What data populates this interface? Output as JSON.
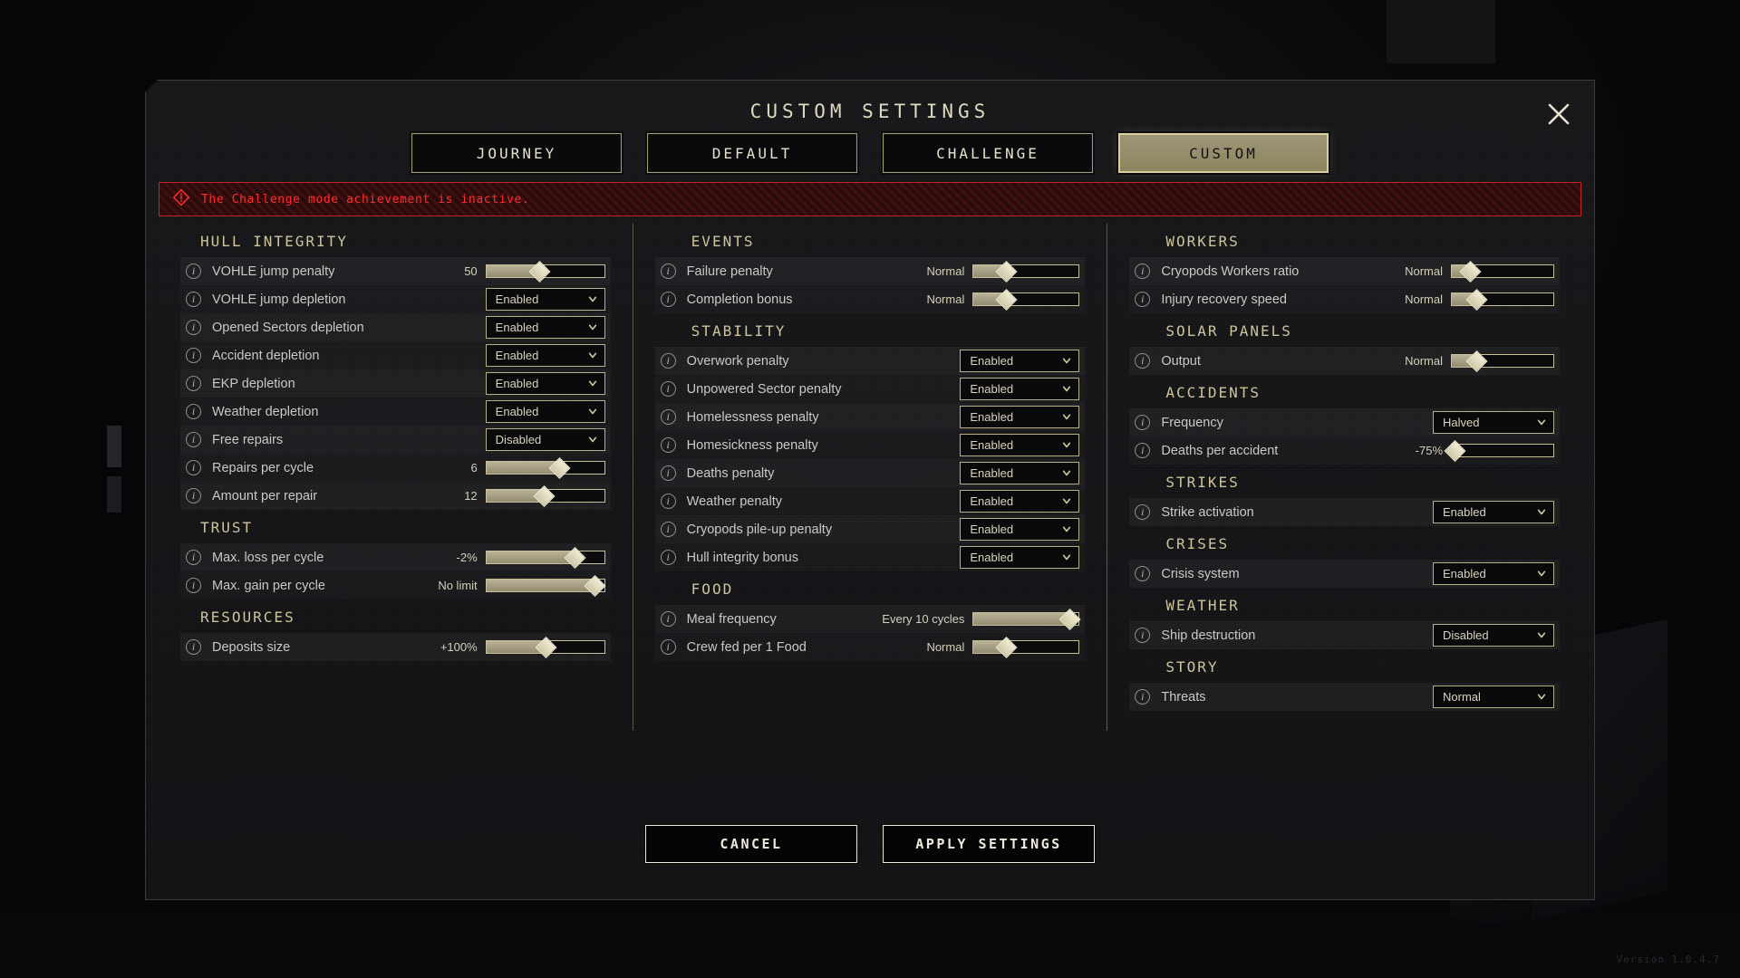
{
  "version_label": "Version 1.0.4.7",
  "dialog": {
    "title": "CUSTOM SETTINGS",
    "close_icon": "close-icon"
  },
  "preset_tabs": [
    {
      "label": "JOURNEY",
      "active": false
    },
    {
      "label": "DEFAULT",
      "active": false
    },
    {
      "label": "CHALLENGE",
      "active": false
    },
    {
      "label": "CUSTOM",
      "active": true
    }
  ],
  "warning": {
    "icon": "warning-triangle-icon",
    "text": "The Challenge mode achievement is inactive.",
    "color": "#ff2d2d"
  },
  "columns": {
    "left": [
      {
        "title": "HULL INTEGRITY",
        "rows": [
          {
            "label": "VOHLE jump penalty",
            "control": "slider",
            "value": "50",
            "fill": 45
          },
          {
            "label": "VOHLE jump depletion",
            "control": "dropdown",
            "value": "Enabled"
          },
          {
            "label": "Opened Sectors depletion",
            "control": "dropdown",
            "value": "Enabled"
          },
          {
            "label": "Accident depletion",
            "control": "dropdown",
            "value": "Enabled"
          },
          {
            "label": "EKP depletion",
            "control": "dropdown",
            "value": "Enabled"
          },
          {
            "label": "Weather depletion",
            "control": "dropdown",
            "value": "Enabled"
          },
          {
            "label": "Free repairs",
            "control": "dropdown",
            "value": "Disabled"
          },
          {
            "label": "Repairs per cycle",
            "control": "slider",
            "value": "6",
            "fill": 62
          },
          {
            "label": "Amount per repair",
            "control": "slider",
            "value": "12",
            "fill": 49
          }
        ]
      },
      {
        "title": "TRUST",
        "rows": [
          {
            "label": "Max. loss per cycle",
            "control": "slider",
            "value": "-2%",
            "fill": 75
          },
          {
            "label": "Max. gain per cycle",
            "control": "slider",
            "value": "No limit",
            "fill": 92
          }
        ]
      },
      {
        "title": "RESOURCES",
        "rows": [
          {
            "label": "Deposits size",
            "control": "slider",
            "value": "+100%",
            "fill": 50
          }
        ]
      }
    ],
    "mid": [
      {
        "title": "EVENTS",
        "rows": [
          {
            "label": "Failure penalty",
            "control": "slider",
            "value": "Normal",
            "fill": 31
          },
          {
            "label": "Completion bonus",
            "control": "slider",
            "value": "Normal",
            "fill": 31
          }
        ]
      },
      {
        "title": "STABILITY",
        "rows": [
          {
            "label": "Overwork penalty",
            "control": "dropdown",
            "value": "Enabled"
          },
          {
            "label": "Unpowered Sector penalty",
            "control": "dropdown",
            "value": "Enabled"
          },
          {
            "label": "Homelessness penalty",
            "control": "dropdown",
            "value": "Enabled"
          },
          {
            "label": "Homesickness penalty",
            "control": "dropdown",
            "value": "Enabled"
          },
          {
            "label": "Deaths penalty",
            "control": "dropdown",
            "value": "Enabled"
          },
          {
            "label": "Weather penalty",
            "control": "dropdown",
            "value": "Enabled"
          },
          {
            "label": "Cryopods pile-up penalty",
            "control": "dropdown",
            "value": "Enabled"
          },
          {
            "label": "Hull integrity bonus",
            "control": "dropdown",
            "value": "Enabled"
          }
        ]
      },
      {
        "title": "FOOD",
        "rows": [
          {
            "label": "Meal frequency",
            "control": "slider",
            "value": "Every 10 cycles",
            "fill": 91
          },
          {
            "label": "Crew fed per 1 Food",
            "control": "slider",
            "value": "Normal",
            "fill": 31
          }
        ]
      }
    ],
    "right": [
      {
        "title": "WORKERS",
        "rows": [
          {
            "label": "Cryopods Workers ratio",
            "control": "slider",
            "value": "Normal",
            "fill": 18
          },
          {
            "label": "Injury recovery speed",
            "control": "slider",
            "value": "Normal",
            "fill": 24
          }
        ]
      },
      {
        "title": "SOLAR PANELS",
        "rows": [
          {
            "label": "Output",
            "control": "slider",
            "value": "Normal",
            "fill": 24
          }
        ]
      },
      {
        "title": "ACCIDENTS",
        "rows": [
          {
            "label": "Frequency",
            "control": "dropdown",
            "value": "Halved"
          },
          {
            "label": "Deaths per accident",
            "control": "slider",
            "value": "-75%",
            "fill": 3
          }
        ]
      },
      {
        "title": "STRIKES",
        "rows": [
          {
            "label": "Strike activation",
            "control": "dropdown",
            "value": "Enabled"
          }
        ]
      },
      {
        "title": "CRISES",
        "rows": [
          {
            "label": "Crisis system",
            "control": "dropdown",
            "value": "Enabled"
          }
        ]
      },
      {
        "title": "WEATHER",
        "rows": [
          {
            "label": "Ship destruction",
            "control": "dropdown",
            "value": "Disabled"
          }
        ]
      },
      {
        "title": "STORY",
        "rows": [
          {
            "label": "Threats",
            "control": "dropdown",
            "value": "Normal"
          }
        ]
      }
    ]
  },
  "footer": {
    "cancel_label": "CANCEL",
    "apply_label": "APPLY SETTINGS"
  }
}
